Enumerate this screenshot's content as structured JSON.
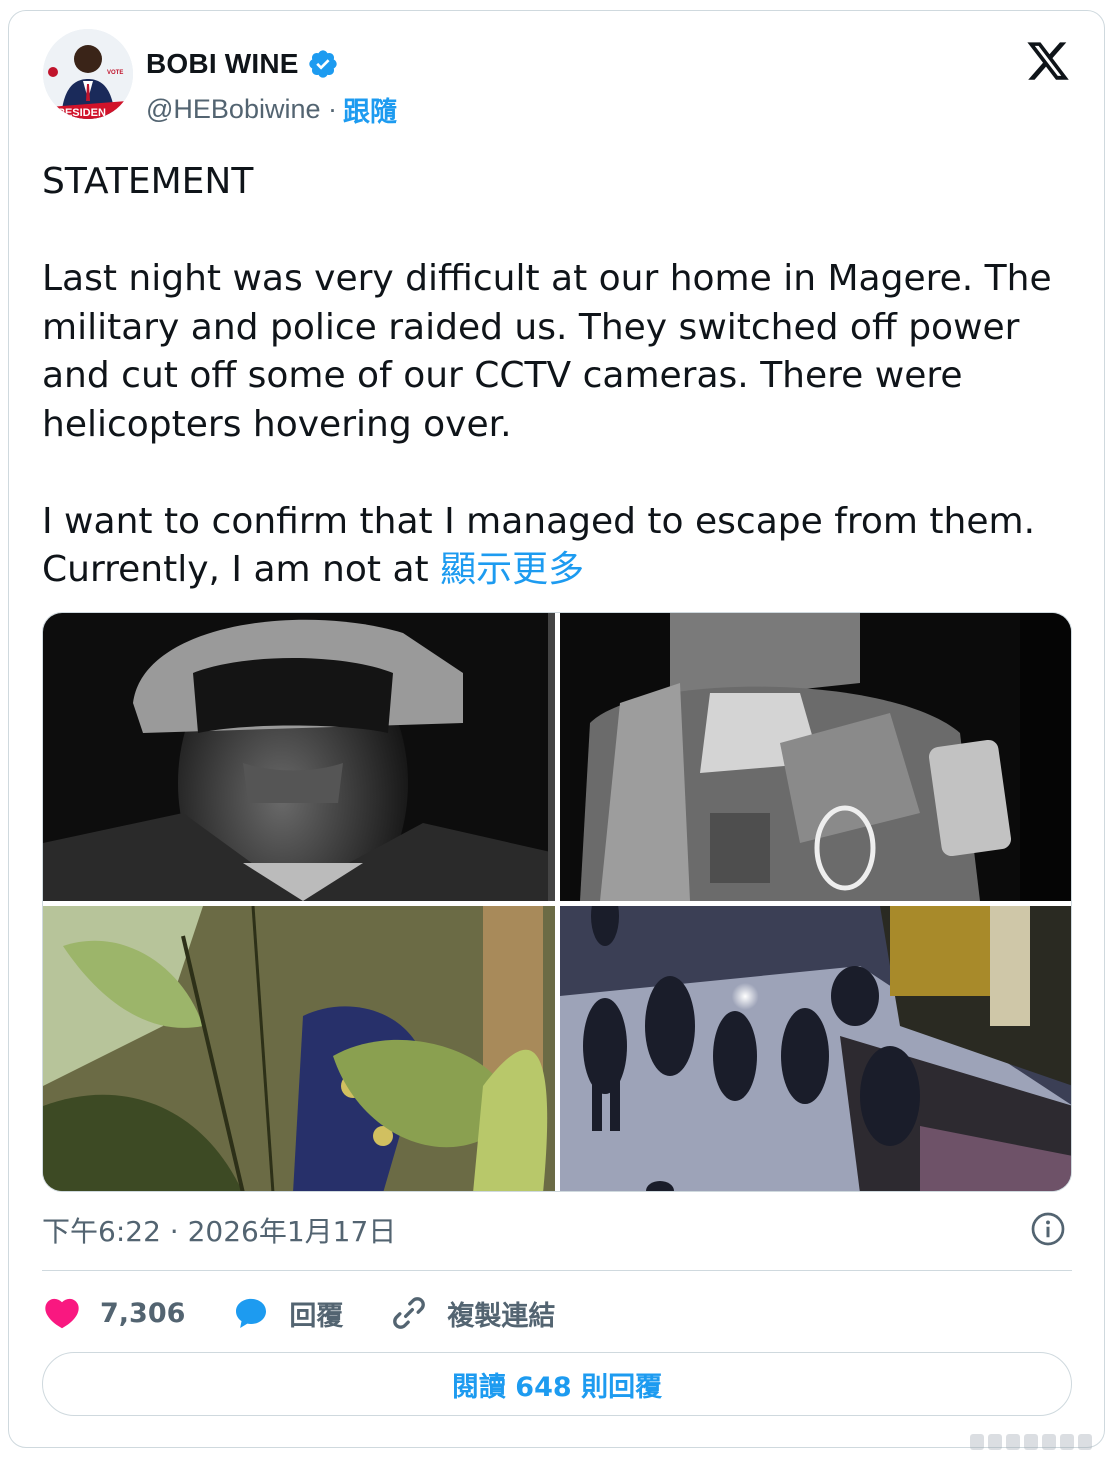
{
  "author": {
    "display_name": "BOBI WINE",
    "handle_line": "@HEBobiwine ·",
    "follow_label": "跟隨",
    "avatar_banner_text": "RESIDEN",
    "avatar_badge_text": "VOTE"
  },
  "post": {
    "heading": "STATEMENT",
    "paragraph1": "Last night was very difficult at our home in Magere. The military and police raided us. They switched off power and cut off some of our CCTV cameras. There were helicopters hovering over.",
    "paragraph2": "I want to confirm that I managed to escape from them. Currently, I am not at",
    "show_more_label": "顯示更多",
    "timestamp": "下午6:22 · 2026年1月17日"
  },
  "media": [
    {
      "description_icon": "photo-soldier-closeup"
    },
    {
      "description_icon": "photo-soldier-vest"
    },
    {
      "description_icon": "photo-bushes"
    },
    {
      "description_icon": "photo-night-street"
    }
  ],
  "actions": {
    "like_count": "7,306",
    "reply_label": "回覆",
    "copy_link_label": "複製連結",
    "read_replies_label": "閱讀 648 則回覆"
  },
  "colors": {
    "accent": "#1d9bf0",
    "like": "#f91880",
    "text": "#0f1419",
    "muted": "#536471",
    "border": "#cfd9de"
  }
}
